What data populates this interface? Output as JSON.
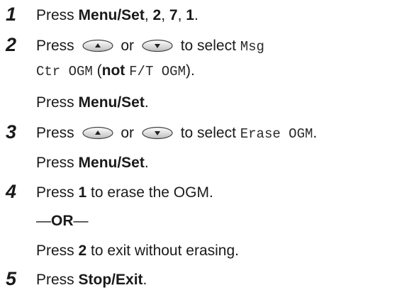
{
  "steps": [
    {
      "number": "1",
      "lines": [
        {
          "press": "Press ",
          "key1": "Menu/Set",
          "sep1": ", ",
          "key2": "2",
          "sep2": ", ",
          "key3": "7",
          "sep3": ", ",
          "key4": "1",
          "end": "."
        }
      ]
    },
    {
      "number": "2",
      "lines": [
        {
          "press": "Press ",
          "or": " or ",
          "to_select": " to select ",
          "display": "Msg"
        },
        {
          "display_cont": "Ctr OGM",
          "paren_open": " (",
          "not_word": "not",
          "space": " ",
          "alt_display": "F/T OGM",
          "paren_close": ")."
        },
        {
          "press": "Press ",
          "key": "Menu/Set",
          "end": "."
        }
      ]
    },
    {
      "number": "3",
      "lines": [
        {
          "press": "Press ",
          "or": " or ",
          "to_select": " to select ",
          "display": "Erase OGM",
          "end": "."
        },
        {
          "press": "Press ",
          "key": "Menu/Set",
          "end": "."
        }
      ]
    },
    {
      "number": "4",
      "lines": [
        {
          "press": "Press ",
          "key": "1",
          "rest": " to erase the OGM."
        },
        {
          "dash1": "—",
          "or_word": "OR",
          "dash2": "—"
        },
        {
          "press": "Press ",
          "key": "2",
          "rest": " to exit without erasing."
        }
      ]
    },
    {
      "number": "5",
      "lines": [
        {
          "press": "Press ",
          "key": "Stop/Exit",
          "end": "."
        }
      ]
    }
  ],
  "icons": {
    "up": "up-arrow-button-icon",
    "down": "down-arrow-button-icon"
  }
}
